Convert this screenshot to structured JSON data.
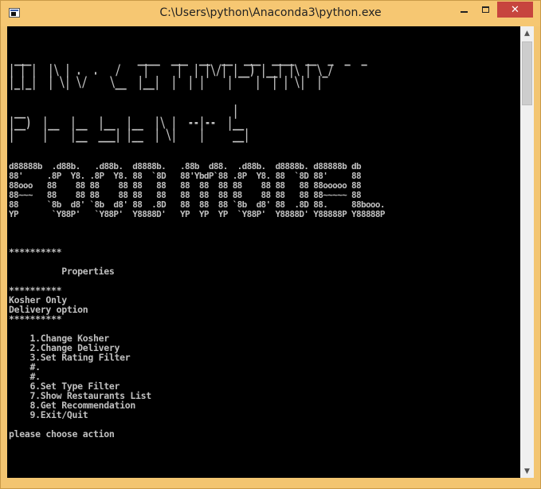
{
  "window": {
    "title": "C:\\Users\\python\\Anaconda3\\python.exe",
    "icons": {
      "app": "console-app-icon",
      "minimize": "minimize-icon",
      "maximize": "maximize-icon",
      "close": "close-icon"
    },
    "close_label": "✕"
  },
  "console": {
    "art_univ": [
      " ___                   ____  ___  __  __  ___  ____  __  _  _  _",
      "| | |  |\\ | .  .   /    |     |  | |\\/| |__) |__| |\\ | \\_/",
      "|_|_|  | \\| \\/    \\__  |__|  |  | |    |    |  | | \\|  |"
    ],
    "art_presents": [
      " __                                     |",
      "|__)  |__  |__  |__  |__  |\\ |  --|--  |__",
      "|     |    |__  ___| |__  | \\|    |     __|"
    ],
    "banner": "d88888b  .d88b.   .d88b.  d8888b.   .88b  d88.  .d88b.  d8888b. d88888b db\n88'     .8P  Y8. .8P  Y8. 88  `8D   88'YbdP`88 .8P  Y8. 88  `8D 88'     88\n88ooo   88    88 88    88 88   88   88  88  88 88    88 88   88 88ooooo 88\n88~~~   88    88 88    88 88   88   88  88  88 88    88 88   88 88~~~~~ 88\n88      `8b  d8' `8b  d8' 88  .8D   88  88  88 `8b  d8' 88  .8D 88.     88booo.\nYP       `Y88P'   `Y88P'  Y8888D'   YP  YP  YP  `Y88P'  Y8888D' Y88888P Y88888P",
    "menu": "\n**********\n\n          Properties\n\n**********\nKosher Only\nDelivery option\n**********\n\n    1.Change Kosher\n    2.Change Delivery\n    3.Set Rating Filter\n    #.\n    #.\n    6.Set Type Filter\n    7.Show Restaurants List\n    8.Get Recommendation\n    9.Exit/Quit\n\nplease choose action"
  },
  "scrollbar": {
    "up_icon": "scroll-up-arrow-icon",
    "down_icon": "scroll-down-arrow-icon",
    "up_glyph": "▲",
    "down_glyph": "▼"
  }
}
